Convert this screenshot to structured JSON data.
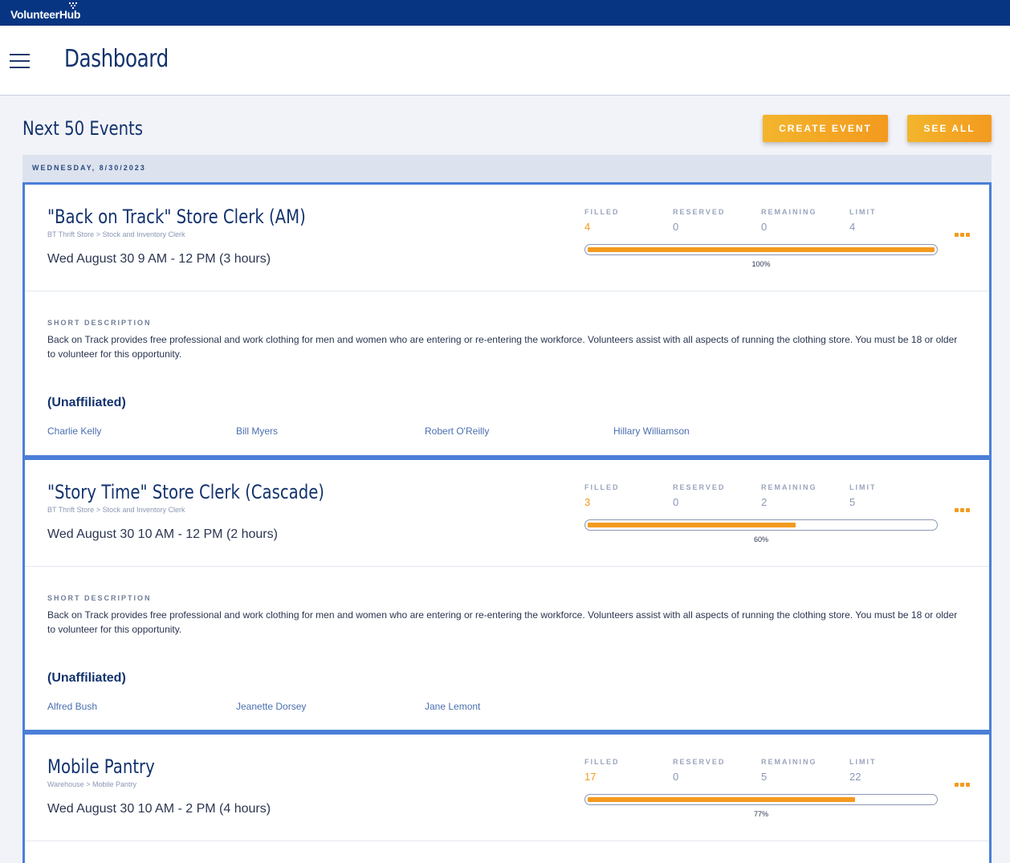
{
  "app": {
    "logo_text": "VolunteerHub"
  },
  "header": {
    "page_title": "Dashboard"
  },
  "section": {
    "title": "Next 50 Events",
    "create_event_label": "CREATE EVENT",
    "see_all_label": "SEE ALL"
  },
  "date_group": {
    "label": "WEDNESDAY, 8/30/2023"
  },
  "stat_labels": {
    "filled": "FILLED",
    "reserved": "RESERVED",
    "remaining": "REMAINING",
    "limit": "LIMIT"
  },
  "short_description_label": "SHORT DESCRIPTION",
  "colors": {
    "topbar": "#083582",
    "accent": "#f39a1e",
    "card_border": "#4a7fd8",
    "title": "#13336e"
  },
  "events": [
    {
      "title": "\"Back on Track\" Store Clerk (AM)",
      "crumb": "BT Thrift Store > Stock and Inventory Clerk",
      "time": "Wed August 30 9 AM - 12 PM (3 hours)",
      "filled": "4",
      "reserved": "0",
      "remaining": "0",
      "limit": "4",
      "percent_text": "100%",
      "percent": 1.0,
      "description": "Back on Track provides free professional and work clothing for men and women who are entering or re-entering the workforce. Volunteers assist with all aspects of running the clothing store. You must be 18 or older to volunteer for this opportunity.",
      "affiliation": "(Unaffiliated)",
      "volunteers": [
        "Charlie Kelly",
        "Bill Myers",
        "Robert O'Reilly",
        "Hillary Williamson"
      ]
    },
    {
      "title": "\"Story Time\" Store Clerk (Cascade)",
      "crumb": "BT Thrift Store > Stock and Inventory Clerk",
      "time": "Wed August 30 10 AM - 12 PM (2 hours)",
      "filled": "3",
      "reserved": "0",
      "remaining": "2",
      "limit": "5",
      "percent_text": "60%",
      "percent": 0.6,
      "description": "Back on Track provides free professional and work clothing for men and women who are entering or re-entering the workforce. Volunteers assist with all aspects of running the clothing store. You must be 18 or older to volunteer for this opportunity.",
      "affiliation": "(Unaffiliated)",
      "volunteers": [
        "Alfred Bush",
        "Jeanette Dorsey",
        "Jane Lemont"
      ]
    },
    {
      "title": "Mobile Pantry",
      "crumb": "Warehouse > Mobile Pantry",
      "time": "Wed August 30 10 AM - 2 PM (4 hours)",
      "filled": "17",
      "reserved": "0",
      "remaining": "5",
      "limit": "22",
      "percent_text": "77%",
      "percent": 0.77
    }
  ]
}
